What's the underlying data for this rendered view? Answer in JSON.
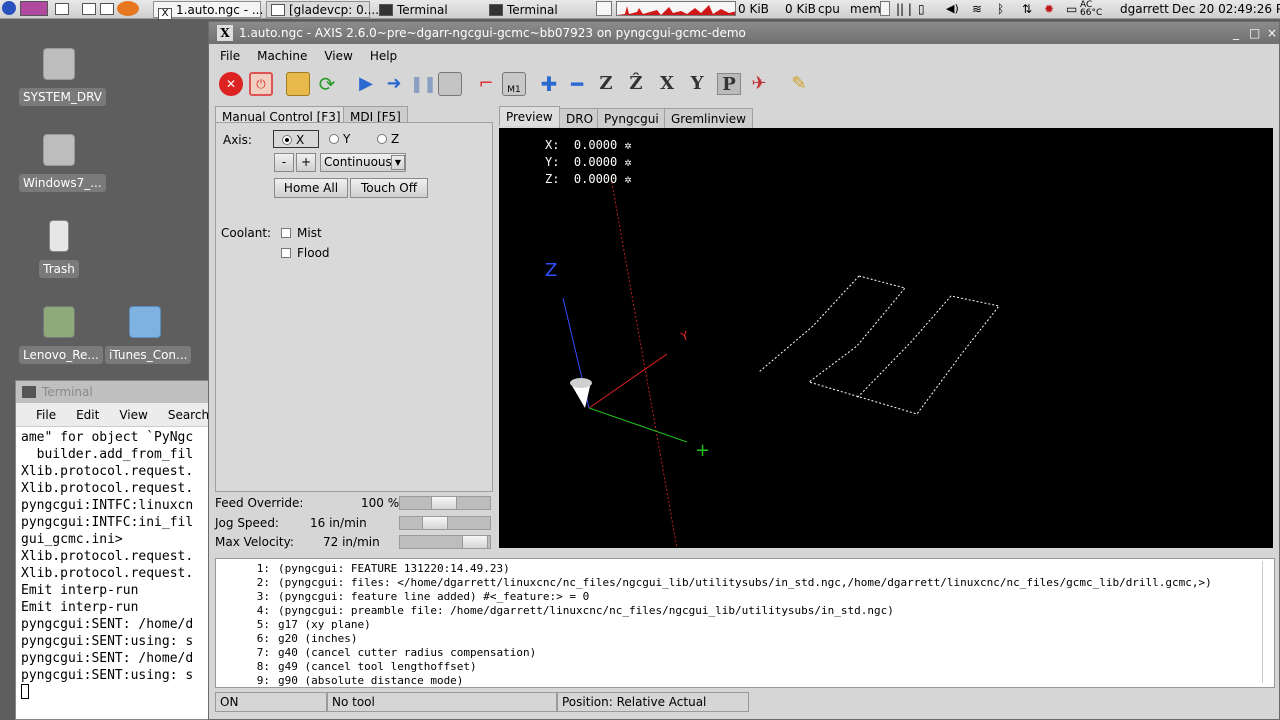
{
  "topbar": {
    "tasks": [
      "1.auto.ngc - ...",
      "[gladevcp: 0....",
      "Terminal",
      "Terminal"
    ],
    "net": [
      "0 KiB",
      "0 KiB"
    ],
    "cpu_label": "cpu",
    "mem_label": "mem",
    "battery": {
      "top": "AC",
      "bottom": "66°C"
    },
    "user": "dgarrett",
    "clock": "Dec 20 02:49:26 P"
  },
  "desktop": {
    "icons": [
      {
        "label": "SYSTEM_DRV"
      },
      {
        "label": "Windows7_..."
      },
      {
        "label": "Trash"
      },
      {
        "label": "Lenovo_Re..."
      },
      {
        "label": "iTunes_Con..."
      }
    ]
  },
  "terminal": {
    "title": "Terminal",
    "menu": [
      "File",
      "Edit",
      "View",
      "Search"
    ],
    "lines": [
      "ame\" for object `PyNgc",
      "  builder.add_from_fil",
      "Xlib.protocol.request.",
      "Xlib.protocol.request.",
      "pyngcgui:INTFC:linuxcn",
      "pyngcgui:INTFC:ini_fil",
      "gui_gcmc.ini>",
      "Xlib.protocol.request.",
      "Xlib.protocol.request.",
      "Emit interp-run",
      "Emit interp-run",
      "pyngcgui:SENT: /home/d",
      "pyngcgui:SENT:using: s",
      "pyngcgui:SENT: /home/d",
      "pyngcgui:SENT:using: s"
    ]
  },
  "window": {
    "title": "1.auto.ngc - AXIS 2.6.0~pre~dgarr-ngcgui-gcmc~bb07923 on pyngcgui-gcmc-demo",
    "controls": [
      "_",
      "□",
      "×"
    ]
  },
  "menubar": [
    "File",
    "Machine",
    "View",
    "Help"
  ],
  "left_tabs": [
    "Manual Control [F3]",
    "MDI [F5]"
  ],
  "manual": {
    "axis_label": "Axis:",
    "axes": [
      "X",
      "Y",
      "Z"
    ],
    "selected_axis": "X",
    "jog_minus": "-",
    "jog_plus": "+",
    "jog_mode": "Continuous",
    "home_all": "Home All",
    "touch_off": "Touch Off",
    "coolant_label": "Coolant:",
    "mist": "Mist",
    "flood": "Flood"
  },
  "sliders": {
    "feed_label": "Feed Override:",
    "feed_value": "100 %",
    "feed_level": 0.5,
    "jog_label": "Jog Speed:",
    "jog_value": "16 in/min",
    "jog_level": 0.35,
    "maxv_label": "Max Velocity:",
    "maxv_value": "72 in/min",
    "maxv_level": 1.0
  },
  "right_tabs": [
    "Preview",
    "DRO",
    "Pyngcgui",
    "Gremlinview"
  ],
  "dro": [
    {
      "axis": "X:",
      "value": "0.0000"
    },
    {
      "axis": "Y:",
      "value": "0.0000"
    },
    {
      "axis": "Z:",
      "value": "0.0000"
    }
  ],
  "gcode": [
    {
      "n": "1:",
      "text": "(pyngcgui: FEATURE 131220:14.49.23)"
    },
    {
      "n": "2:",
      "text": "(pyngcgui: files: </home/dgarrett/linuxcnc/nc_files/ngcgui_lib/utilitysubs/in_std.ngc,/home/dgarrett/linuxcnc/nc_files/gcmc_lib/drill.gcmc,>)"
    },
    {
      "n": "3:",
      "text": "(pyngcgui: feature line added) #<_feature:> = 0"
    },
    {
      "n": "4:",
      "text": "(pyngcgui: preamble file: /home/dgarrett/linuxcnc/nc_files/ngcgui_lib/utilitysubs/in_std.ngc)"
    },
    {
      "n": "5:",
      "text": "g17 (xy plane)"
    },
    {
      "n": "6:",
      "text": "g20 (inches)"
    },
    {
      "n": "7:",
      "text": "g40 (cancel cutter radius compensation)"
    },
    {
      "n": "8:",
      "text": "g49 (cancel tool lengthoffset)"
    },
    {
      "n": "9:",
      "text": "g90 (absolute distance mode)"
    }
  ],
  "status": {
    "state": "ON",
    "tool": "No tool",
    "position": "Position: Relative Actual"
  },
  "colors": {
    "x_axis": "#e02020",
    "y_axis": "#20c020",
    "z_axis": "#3050ff",
    "toolpath": "#ffffff"
  }
}
